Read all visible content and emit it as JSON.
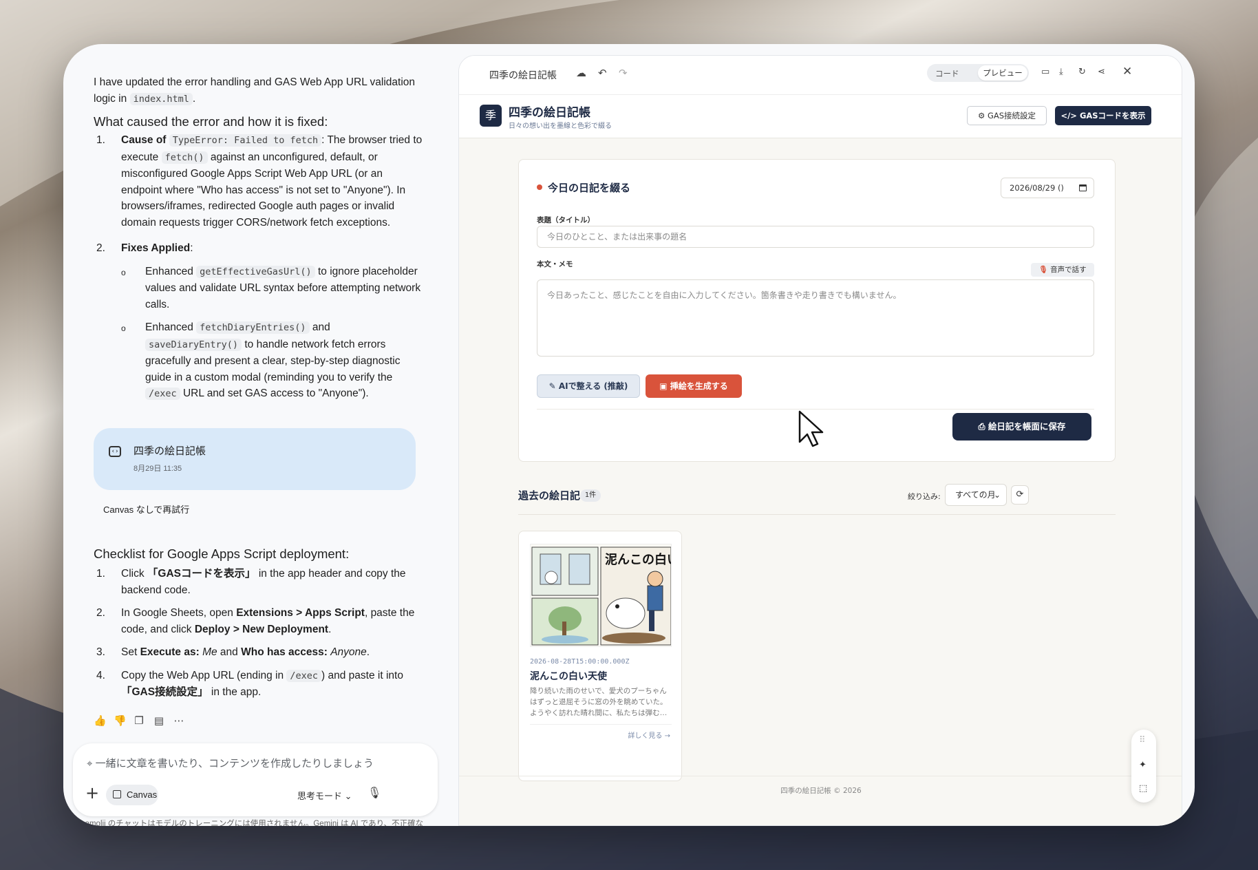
{
  "chat": {
    "intro_a": "I have updated the error handling and GAS Web App URL validation logic in ",
    "intro_code": "index.html",
    "intro_b": ".",
    "heading1": "What caused the error and how it is fixed:",
    "cause_label": "Cause of",
    "cause_code": "TypeError: Failed to fetch",
    "cause_text_a": ": The browser tried to execute",
    "cause_code2": "fetch()",
    "cause_text_b": "against an unconfigured, default, or misconfigured Google Apps Script Web App URL (or an endpoint where \"Who has access\" is not set to \"Anyone\"). In browsers/iframes, redirected Google auth pages or invalid domain requests trigger CORS/network fetch exceptions.",
    "fixes_label": "Fixes Applied",
    "fix1_a": "Enhanced",
    "fix1_code": "getEffectiveGasUrl()",
    "fix1_b": "to ignore placeholder values and validate URL syntax before attempting network calls.",
    "fix2_a": "Enhanced",
    "fix2_code": "fetchDiaryEntries()",
    "fix2_b": "and",
    "fix2_code2": "saveDiaryEntry()",
    "fix2_c": "to handle network fetch errors gracefully and present a clear, step-by-step diagnostic guide in a custom modal (reminding you to verify the",
    "fix2_code3": "/exec",
    "fix2_d": "URL and set GAS access to \"Anyone\").",
    "card_title": "四季の絵日記帳",
    "card_date": "8月29日 11:35",
    "retry": "Canvas なしで再試行",
    "heading2": "Checklist for Google Apps Script deployment:",
    "c1_a": "Click",
    "c1_b": "「GASコードを表示」",
    "c1_c": "in the app header and copy the backend code.",
    "c2_a": "In Google Sheets, open",
    "c2_b": "Extensions > Apps Script",
    "c2_c": ", paste the code, and click",
    "c2_d": "Deploy > New Deployment",
    "c2_e": ".",
    "c3_a": "Set",
    "c3_b": "Execute as:",
    "c3_c": "Me",
    "c3_d": "and",
    "c3_e": "Who has access:",
    "c3_f": "Anyone",
    "c3_g": ".",
    "c4_a": "Copy the Web App URL (ending in",
    "c4_code": "/exec",
    "c4_b": ") and paste it into",
    "c4_c": "「GAS接続設定」",
    "c4_d": "in the app.",
    "input_placeholder": "一緒に文章を書いたり、コンテンツを作成したりしましょう",
    "canvas_chip": "Canvas",
    "mode": "思考モード",
    "disclaimer": "mamolii のチャットはモデルのトレーニングには使用されません。Gemini は AI であり、不正確な"
  },
  "panel": {
    "title": "四季の絵日記帳",
    "seg_code": "コード",
    "seg_preview": "プレビュー"
  },
  "app": {
    "logo": "季",
    "title": "四季の絵日記帳",
    "subtitle": "日々の想い出を墨線と色彩で綴る",
    "gas_settings": "GAS接続設定",
    "show_code": "GASコードを表示",
    "form_title": "今日の日記を綴る",
    "date": "2026/08/29 ()",
    "title_label": "表題（タイトル）",
    "title_placeholder": "今日のひとこと、または出来事の題名",
    "body_label": "本文・メモ",
    "voice": "音声で話す",
    "body_placeholder": "今日あったこと、感じたことを自由に入力してください。箇条書きや走り書きでも構いません。",
    "ai_button": "AIで整える (推敲)",
    "img_button": "挿絵を生成する",
    "save_button": "絵日記を帳面に保存",
    "past_title": "過去の絵日記",
    "count": "1件",
    "filter_label": "絞り込み:",
    "filter_value": "すべての月",
    "entry_date": "2026-08-28T15:00:00.000Z",
    "entry_title": "泥んこの白い天使",
    "entry_body": "降り続いた雨のせいで、愛犬のプーちゃんはずっと退屈そうに窓の外を眺めていた。ようやく訪れた晴れ間に、私たちは弾む心で外へと踏み出す…",
    "entry_more": "詳しく見る →",
    "footer": "四季の絵日記帳 © 2026",
    "illus_text": "泥んこの白い天"
  }
}
